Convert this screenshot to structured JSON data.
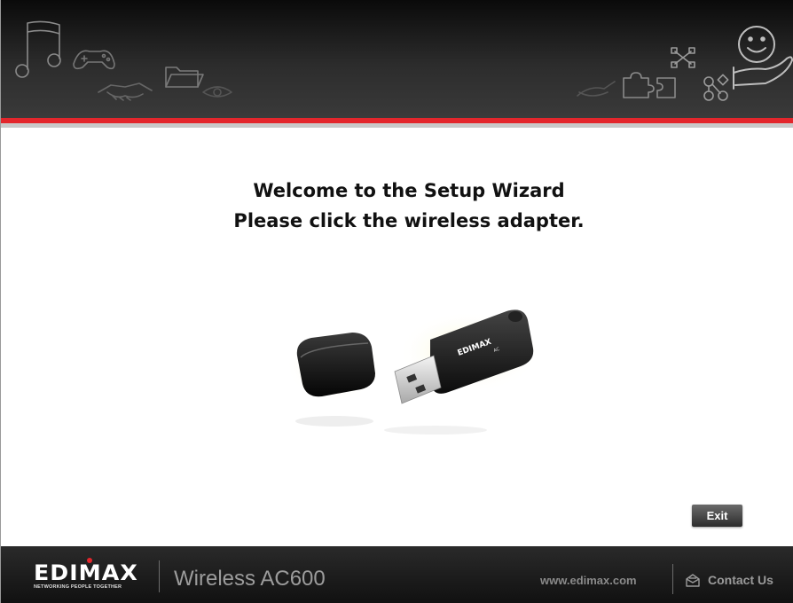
{
  "welcome": {
    "line1": "Welcome to the Setup Wizard",
    "line2": "Please click the wireless adapter."
  },
  "adapter": {
    "brand_text": "EDIMAX",
    "model_text": "AC"
  },
  "buttons": {
    "exit_label": "Exit"
  },
  "footer": {
    "logo_text": "EDIMAX",
    "logo_tagline": "NETWORKING PEOPLE TOGETHER",
    "product_name": "Wireless AC600",
    "website": "www.edimax.com",
    "contact_label": "Contact Us",
    "contact_icon": "envelope-icon"
  },
  "header_icons": [
    "music-note-icon",
    "gamepad-icon",
    "handshake-icon",
    "folder-icon",
    "eye-icon",
    "pen-icon",
    "puzzle-icon",
    "network-icon",
    "smiley-hand-icon"
  ],
  "colors": {
    "accent_red": "#e3262c",
    "header_dark": "#1e1e1e",
    "footer_dark": "#1a1a1a",
    "text_dark": "#111111"
  }
}
